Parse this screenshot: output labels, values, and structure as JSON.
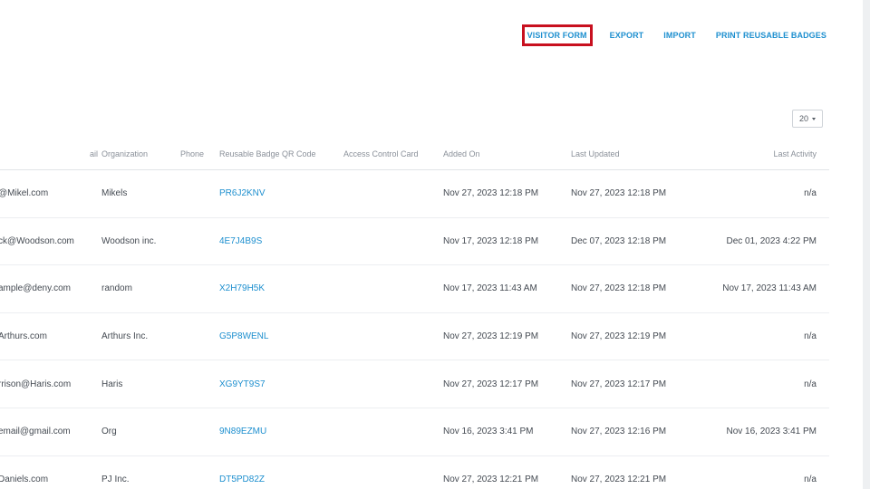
{
  "nav": {
    "visitor_form": "VISITOR FORM",
    "export": "EXPORT",
    "import": "IMPORT",
    "print_badges": "PRINT REUSABLE BADGES"
  },
  "page_size": {
    "value": "20"
  },
  "table": {
    "headers": {
      "email": "ail",
      "organization": "Organization",
      "phone": "Phone",
      "badge": "Reusable Badge QR Code",
      "access": "Access Control Card",
      "added": "Added On",
      "updated": "Last Updated",
      "activity": "Last Activity"
    },
    "rows": [
      {
        "email": "@Mikel.com",
        "org": "Mikels",
        "phone": "",
        "badge": "PR6J2KNV",
        "access": "",
        "added": "Nov 27, 2023 12:18 PM",
        "updated": "Nov 27, 2023 12:18 PM",
        "activity": "n/a"
      },
      {
        "email": "ck@Woodson.com",
        "org": "Woodson inc.",
        "phone": "",
        "badge": "4E7J4B9S",
        "access": "",
        "added": "Nov 17, 2023 12:18 PM",
        "updated": "Dec 07, 2023 12:18 PM",
        "activity": "Dec 01, 2023 4:22 PM"
      },
      {
        "email": "ample@deny.com",
        "org": "random",
        "phone": "",
        "badge": "X2H79H5K",
        "access": "",
        "added": "Nov 17, 2023 11:43 AM",
        "updated": "Nov 27, 2023 12:18 PM",
        "activity": "Nov 17, 2023 11:43 AM"
      },
      {
        "email": "Arthurs.com",
        "org": "Arthurs Inc.",
        "phone": "",
        "badge": "G5P8WENL",
        "access": "",
        "added": "Nov 27, 2023 12:19 PM",
        "updated": "Nov 27, 2023 12:19 PM",
        "activity": "n/a"
      },
      {
        "email": "rrison@Haris.com",
        "org": "Haris",
        "phone": "",
        "badge": "XG9YT9S7",
        "access": "",
        "added": "Nov 27, 2023 12:17 PM",
        "updated": "Nov 27, 2023 12:17 PM",
        "activity": "n/a"
      },
      {
        "email": "email@gmail.com",
        "org": "Org",
        "phone": "",
        "badge": "9N89EZMU",
        "access": "",
        "added": "Nov 16, 2023 3:41 PM",
        "updated": "Nov 27, 2023 12:16 PM",
        "activity": "Nov 16, 2023 3:41 PM"
      },
      {
        "email": "Daniels.com",
        "org": "PJ Inc.",
        "phone": "",
        "badge": "DT5PD82Z",
        "access": "",
        "added": "Nov 27, 2023 12:21 PM",
        "updated": "Nov 27, 2023 12:21 PM",
        "activity": "n/a"
      }
    ]
  }
}
